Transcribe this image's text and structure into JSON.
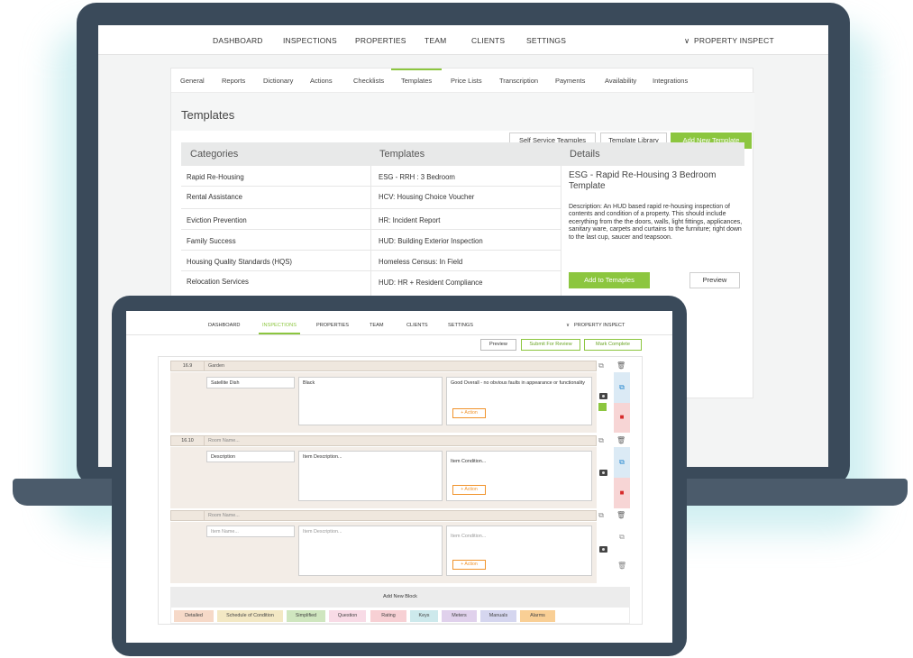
{
  "laptop": {
    "nav": {
      "items": [
        "DASHBOARD",
        "INSPECTIONS",
        "PROPERTIES",
        "TEAM",
        "CLIENTS",
        "SETTINGS"
      ],
      "account_label": "PROPERTY INSPECT"
    },
    "settings_tabs": [
      "General",
      "Reports",
      "Dictionary",
      "Actions",
      "Checklists",
      "Templates",
      "Price Lists",
      "Transcription",
      "Payments",
      "Availability",
      "Integrations"
    ],
    "active_tab": "Templates",
    "page_title": "Templates",
    "buttons": {
      "self_service": "Self Service Teamples",
      "library": "Template Library",
      "add_new": "Add New Template"
    },
    "columns": {
      "categories": "Categories",
      "templates": "Templates",
      "details": "Details"
    },
    "categories": [
      "Rapid Re-Housing",
      "Rental Assistance",
      "Eviction Prevention",
      "Family Success",
      "Housing Quality Standards (HQS)",
      "Relocation Services"
    ],
    "templates": [
      "ESG - RRH : 3 Bedroom",
      "HCV: Housing Choice Voucher",
      "HR: Incident Report",
      "HUD: Building Exterior Inspection",
      "Homeless Census: In Field",
      "HUD: HR + Resident Compliance"
    ],
    "details": {
      "title": "ESG - Rapid Re-Housing 3 Bedroom Template",
      "description": "Description: An HUD based rapid re-housing inspection of contents and condition of a property. This should include ecerything from the the doors, walls, light fittings, applicances, sanitary ware, carpets and curtains to the furniture; right down to the last cup, saucer and teapsoon.",
      "add_button": "Add to Temaples",
      "preview_button": "Preview"
    }
  },
  "tablet": {
    "nav": {
      "items": [
        "DASHBOARD",
        "INSPECTIONS",
        "PROPERTIES",
        "TEAM",
        "CLIENTS",
        "SETTINGS"
      ],
      "active": "INSPECTIONS",
      "account_label": "PROPERTY INSPECT"
    },
    "buttons": {
      "preview": "Preview",
      "submit": "Submit For Review",
      "complete": "Mark Complete"
    },
    "rooms": [
      {
        "num": "16.9",
        "name": "Garden",
        "item": "Satellite Dish",
        "description": "Black",
        "condition": "Good Overall - no obvious faults in appearance or functionality",
        "action": "+ Action"
      },
      {
        "num": "16.10",
        "name": "Room Name...",
        "item": "Description",
        "description": "Item Description...",
        "condition": "Item Condition...",
        "action": "+ Action"
      },
      {
        "num": "",
        "name": "Room Name...",
        "item": "Item Name...",
        "description": "Item Description...",
        "condition": "Item Condition...",
        "action": "+ Action"
      }
    ],
    "add_block": "Add New Block",
    "block_types": [
      {
        "label": "Detailed",
        "color": "#f6d9c8"
      },
      {
        "label": "Schedule of Condition",
        "color": "#f3e8c4"
      },
      {
        "label": "Simplified",
        "color": "#cfe6bf"
      },
      {
        "label": "Question",
        "color": "#f8dbe6"
      },
      {
        "label": "Rating",
        "color": "#f7d0d4"
      },
      {
        "label": "Keys",
        "color": "#cde9ec"
      },
      {
        "label": "Meters",
        "color": "#e0d1ec"
      },
      {
        "label": "Manuals",
        "color": "#d5d6ef"
      },
      {
        "label": "Alarms",
        "color": "#f9cf95"
      }
    ]
  },
  "colors": {
    "accent_green": "#8cc63f",
    "action_orange": "#f0932b",
    "device_frame": "#3a4a5a"
  }
}
